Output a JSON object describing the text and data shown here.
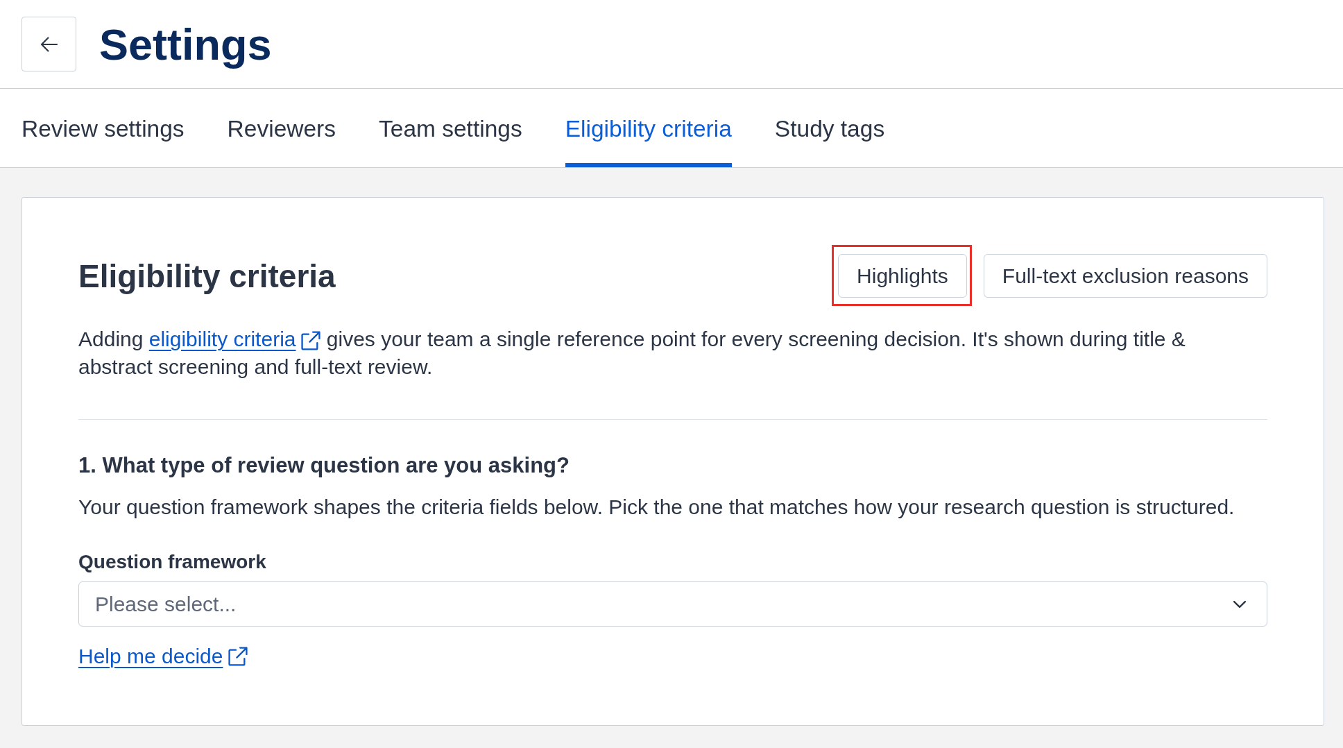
{
  "header": {
    "title": "Settings"
  },
  "tabs": [
    {
      "label": "Review settings",
      "selected": false
    },
    {
      "label": "Reviewers",
      "selected": false
    },
    {
      "label": "Team settings",
      "selected": false
    },
    {
      "label": "Eligibility criteria",
      "selected": true
    },
    {
      "label": "Study tags",
      "selected": false
    }
  ],
  "card": {
    "title": "Eligibility criteria",
    "buttons": [
      {
        "label": "Highlights",
        "outlined": true
      },
      {
        "label": "Full-text exclusion reasons",
        "outlined": false
      }
    ],
    "intro": {
      "before": "Adding ",
      "link": "eligibility criteria",
      "after": " gives your team a single reference point for every screening decision. It's shown during title & abstract screening and full-text review."
    },
    "question": {
      "heading": "1. What type of review question are you asking?",
      "description": "Your question framework shapes the criteria fields below. Pick the one that matches how your research question is structured.",
      "field": {
        "label": "Question framework",
        "placeholder": "Please select..."
      },
      "help_link": "Help me decide"
    }
  }
}
